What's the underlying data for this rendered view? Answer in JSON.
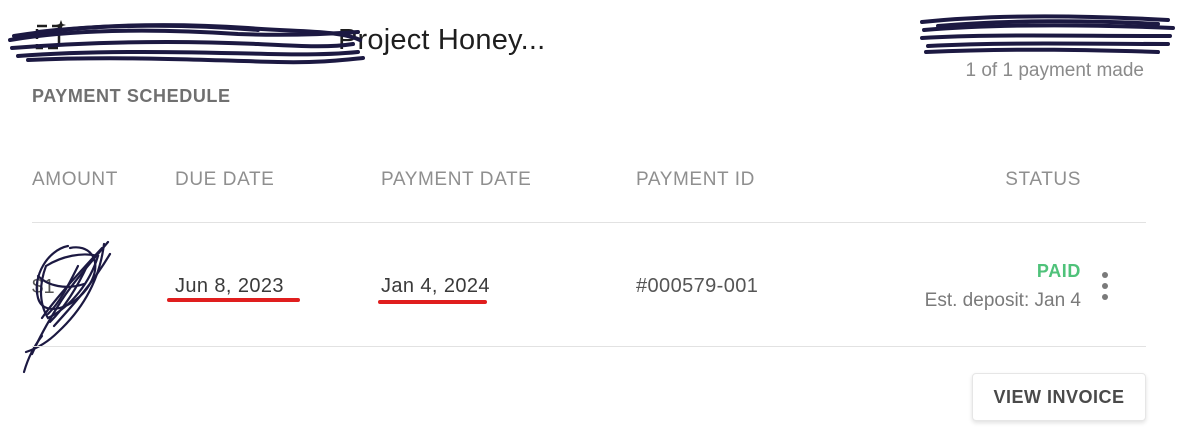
{
  "header": {
    "project_title": "Project Honey...",
    "payment_count": "1 of 1 payment made"
  },
  "schedule": {
    "heading": "PAYMENT SCHEDULE",
    "columns": {
      "amount": "AMOUNT",
      "due_date": "DUE DATE",
      "payment_date": "PAYMENT DATE",
      "payment_id": "PAYMENT ID",
      "status": "STATUS"
    },
    "rows": [
      {
        "amount": "$1",
        "due_date": "Jun 8, 2023",
        "payment_date": "Jan 4, 2024",
        "payment_id": "#000579-001",
        "status": "PAID",
        "status_detail": "Est. deposit: Jan 4"
      }
    ]
  },
  "actions": {
    "view_invoice": "VIEW INVOICE"
  },
  "colors": {
    "paid": "#4fc27a",
    "annotation_underline": "#e01e1e",
    "redaction_scribble": "#1c1942"
  },
  "icons": {
    "project": "sparkle-frame-icon",
    "more": "more-vertical-icon"
  }
}
